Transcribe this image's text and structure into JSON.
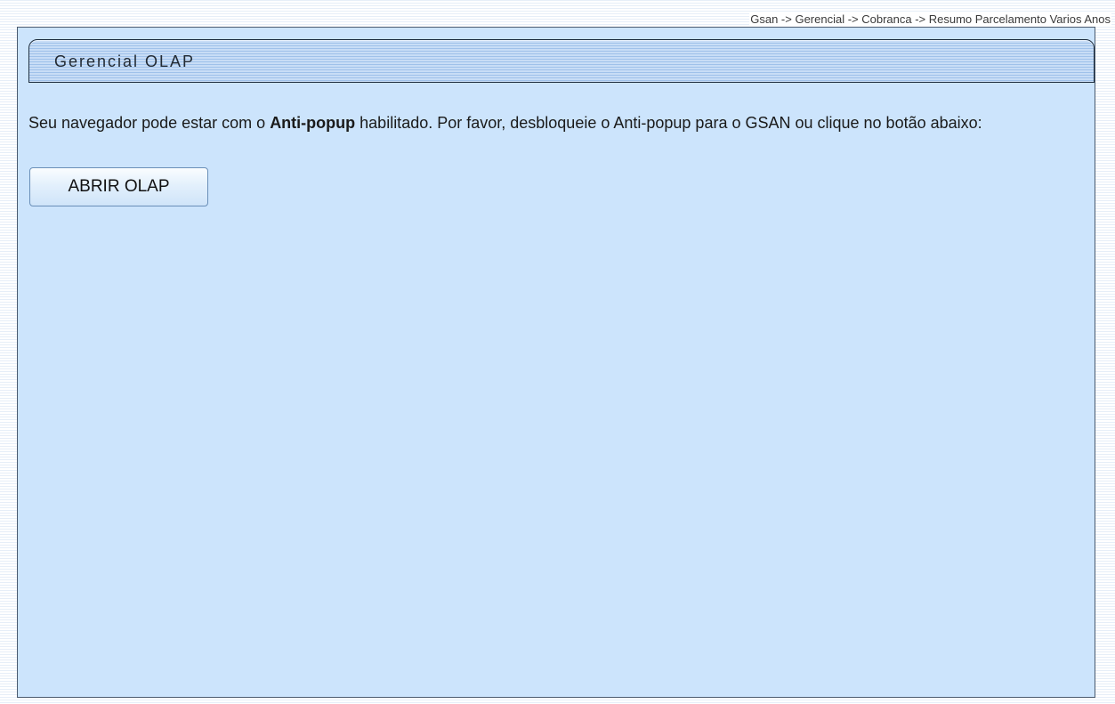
{
  "breadcrumb": {
    "text": "Gsan -> Gerencial -> Cobranca -> Resumo Parcelamento Varios Anos"
  },
  "panel": {
    "title": "Gerencial OLAP",
    "message": {
      "before": "Seu navegador pode estar com o ",
      "bold": "Anti-popup",
      "after": " habilitado. Por favor, desbloqueie o Anti-popup para o GSAN ou clique no botão abaixo:"
    },
    "open_button_label": "ABRIR OLAP"
  },
  "colors": {
    "panel_background": "#cce4fc",
    "header_stripe": "#9fc1ea",
    "border": "#4a5a6e"
  }
}
